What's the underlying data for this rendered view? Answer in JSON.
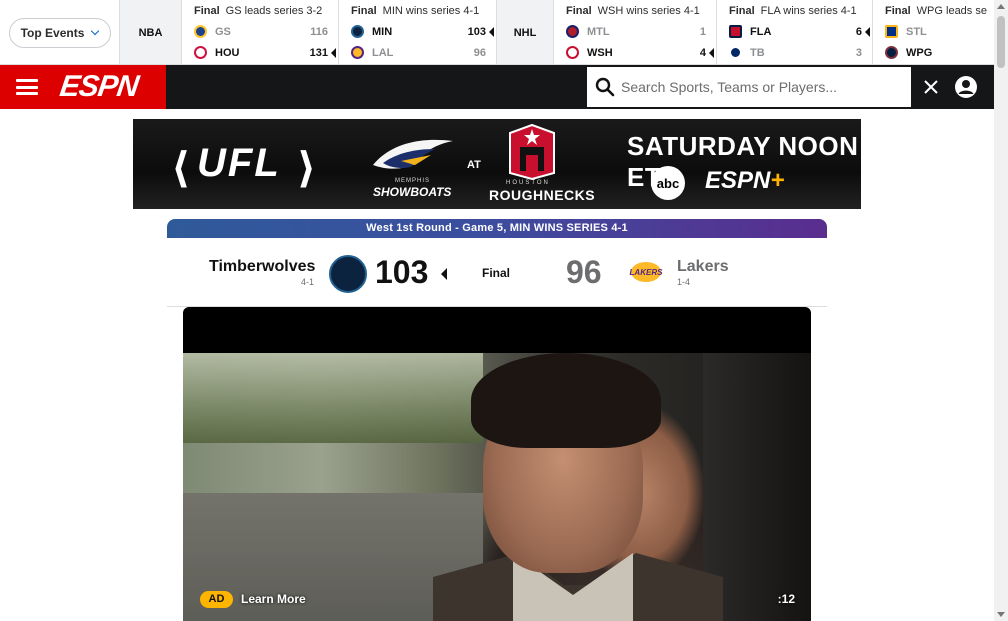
{
  "scoreboard": {
    "top_events_label": "Top Events",
    "leagues": {
      "nba": "NBA",
      "nhl": "NHL"
    },
    "games": [
      {
        "status": "Final",
        "note": "GS leads series 3-2",
        "teams": [
          {
            "abbr": "GS",
            "score": "116",
            "winner": false,
            "color": "#1d428a"
          },
          {
            "abbr": "HOU",
            "score": "131",
            "winner": true,
            "color": "#ce1141"
          }
        ]
      },
      {
        "status": "Final",
        "note": "MIN wins series 4-1",
        "teams": [
          {
            "abbr": "MIN",
            "score": "103",
            "winner": true,
            "color": "#0c2340"
          },
          {
            "abbr": "LAL",
            "score": "96",
            "winner": false,
            "color": "#fdb927"
          }
        ]
      },
      {
        "status": "Final",
        "note": "WSH wins series 4-1",
        "teams": [
          {
            "abbr": "MTL",
            "score": "1",
            "winner": false,
            "color": "#af1e2d"
          },
          {
            "abbr": "WSH",
            "score": "4",
            "winner": true,
            "color": "#c8102e"
          }
        ]
      },
      {
        "status": "Final",
        "note": "FLA wins series 4-1",
        "teams": [
          {
            "abbr": "FLA",
            "score": "6",
            "winner": true,
            "color": "#c8102e"
          },
          {
            "abbr": "TB",
            "score": "3",
            "winner": false,
            "color": "#002868"
          }
        ]
      },
      {
        "status": "Final",
        "note": "WPG leads se",
        "teams": [
          {
            "abbr": "STL",
            "score": "",
            "winner": false,
            "color": "#002f87"
          },
          {
            "abbr": "WPG",
            "score": "",
            "winner": true,
            "color": "#041e42"
          }
        ]
      }
    ]
  },
  "nav": {
    "logo": "ESPN",
    "search_placeholder": "Search Sports, Teams or Players...",
    "brand_red": "#d00000"
  },
  "ad_banner": {
    "league": "UFL",
    "away_city": "MEMPHIS",
    "away_team": "SHOWBOATS",
    "at": "AT",
    "home_city": "HOUSTON",
    "home_team": "ROUGHNECKS",
    "time": "SATURDAY NOON ET",
    "network1": "abc",
    "network2": "ESPN",
    "network2_plus": "+"
  },
  "game_header": {
    "title": "West 1st Round - Game 5, MIN WINS SERIES 4-1",
    "home_team": "Timberwolves",
    "home_record": "4-1",
    "home_score": "103",
    "status": "Final",
    "away_score": "96",
    "away_team": "Lakers",
    "away_record": "1-4"
  },
  "video": {
    "ad_label": "AD",
    "learn_more": "Learn More",
    "time_left": ":12"
  }
}
